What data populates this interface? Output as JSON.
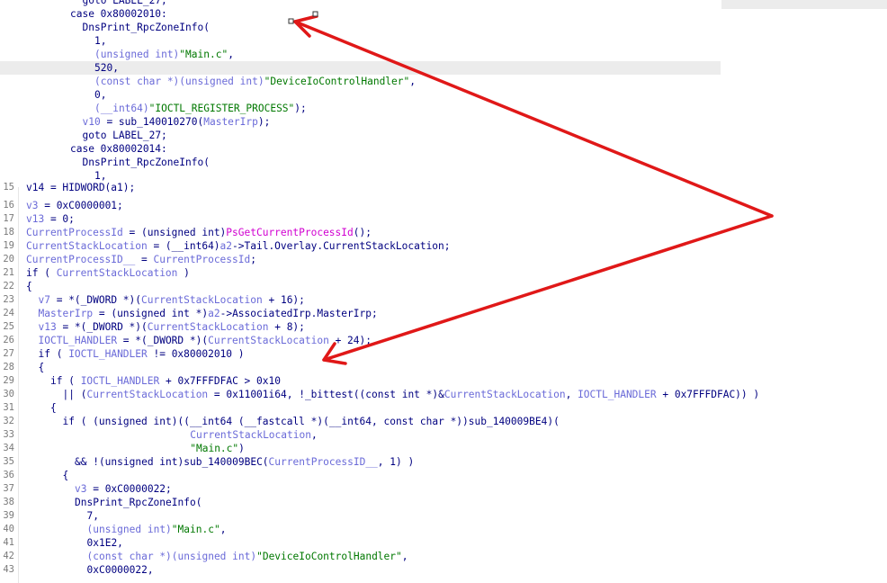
{
  "top_code": [
    {
      "indent": 10,
      "parts": [
        {
          "t": "goto LABEL_27;",
          "c": "kw"
        }
      ]
    },
    {
      "indent": 8,
      "parts": [
        {
          "t": "case 0x80002010:",
          "c": "kw"
        }
      ]
    },
    {
      "indent": 10,
      "parts": [
        {
          "t": "DnsPrint_RpcZoneInfo(",
          "c": "fn"
        }
      ]
    },
    {
      "indent": 12,
      "parts": [
        {
          "t": "1,",
          "c": "num"
        }
      ]
    },
    {
      "indent": 12,
      "parts": [
        {
          "t": "(unsigned int)",
          "c": "var"
        },
        {
          "t": "\"Main.c\"",
          "c": "str"
        },
        {
          "t": ",",
          "c": "kw"
        }
      ]
    },
    {
      "indent": 12,
      "parts": [
        {
          "t": "520,",
          "c": "num"
        }
      ],
      "highlight": true
    },
    {
      "indent": 12,
      "parts": [
        {
          "t": "(const char *)(unsigned int)",
          "c": "var"
        },
        {
          "t": "\"DeviceIoControlHandler\"",
          "c": "str"
        },
        {
          "t": ",",
          "c": "kw"
        }
      ]
    },
    {
      "indent": 12,
      "parts": [
        {
          "t": "0,",
          "c": "num"
        }
      ]
    },
    {
      "indent": 12,
      "parts": [
        {
          "t": "(__int64)",
          "c": "var"
        },
        {
          "t": "\"IOCTL_REGISTER_PROCESS\"",
          "c": "str"
        },
        {
          "t": ");",
          "c": "kw"
        }
      ]
    },
    {
      "indent": 10,
      "parts": [
        {
          "t": "v10",
          "c": "var"
        },
        {
          "t": " = sub_140010270(",
          "c": "kw"
        },
        {
          "t": "MasterIrp",
          "c": "var"
        },
        {
          "t": ");",
          "c": "kw"
        }
      ]
    },
    {
      "indent": 10,
      "parts": [
        {
          "t": "goto LABEL_27;",
          "c": "kw"
        }
      ]
    },
    {
      "indent": 8,
      "parts": [
        {
          "t": "case 0x80002014:",
          "c": "kw"
        }
      ]
    },
    {
      "indent": 10,
      "parts": [
        {
          "t": "DnsPrint_RpcZoneInfo(",
          "c": "fn"
        }
      ]
    },
    {
      "indent": 12,
      "parts": [
        {
          "t": "1,",
          "c": "num"
        }
      ]
    }
  ],
  "bottom_code": [
    {
      "n": "16",
      "indent": 0,
      "parts": [
        {
          "t": "v3",
          "c": "var"
        },
        {
          "t": " = 0xC0000001;",
          "c": "kw"
        }
      ]
    },
    {
      "n": "17",
      "indent": 0,
      "parts": [
        {
          "t": "v13",
          "c": "var"
        },
        {
          "t": " = 0;",
          "c": "kw"
        }
      ]
    },
    {
      "n": "18",
      "indent": 0,
      "parts": [
        {
          "t": "CurrentProcessId",
          "c": "var"
        },
        {
          "t": " = (unsigned int)",
          "c": "kw"
        },
        {
          "t": "PsGetCurrentProcessId",
          "c": "pink"
        },
        {
          "t": "();",
          "c": "kw"
        }
      ]
    },
    {
      "n": "19",
      "indent": 0,
      "parts": [
        {
          "t": "CurrentStackLocation",
          "c": "var"
        },
        {
          "t": " = (__int64)",
          "c": "kw"
        },
        {
          "t": "a2",
          "c": "var"
        },
        {
          "t": "->Tail.Overlay.CurrentStackLocation;",
          "c": "kw"
        }
      ]
    },
    {
      "n": "20",
      "indent": 0,
      "parts": [
        {
          "t": "CurrentProcessID__",
          "c": "var"
        },
        {
          "t": " = ",
          "c": "kw"
        },
        {
          "t": "CurrentProcessId",
          "c": "var"
        },
        {
          "t": ";",
          "c": "kw"
        }
      ]
    },
    {
      "n": "21",
      "indent": 0,
      "parts": [
        {
          "t": "if ( ",
          "c": "kw"
        },
        {
          "t": "CurrentStackLocation",
          "c": "var"
        },
        {
          "t": " )",
          "c": "kw"
        }
      ]
    },
    {
      "n": "22",
      "indent": 0,
      "parts": [
        {
          "t": "{",
          "c": "kw"
        }
      ]
    },
    {
      "n": "23",
      "indent": 2,
      "parts": [
        {
          "t": "v7",
          "c": "var"
        },
        {
          "t": " = *(_DWORD *)(",
          "c": "kw"
        },
        {
          "t": "CurrentStackLocation",
          "c": "var"
        },
        {
          "t": " + 16);",
          "c": "kw"
        }
      ]
    },
    {
      "n": "24",
      "indent": 2,
      "parts": [
        {
          "t": "MasterIrp",
          "c": "var"
        },
        {
          "t": " = (unsigned int *)",
          "c": "kw"
        },
        {
          "t": "a2",
          "c": "var"
        },
        {
          "t": "->AssociatedIrp.MasterIrp;",
          "c": "kw"
        }
      ]
    },
    {
      "n": "25",
      "indent": 2,
      "parts": [
        {
          "t": "v13",
          "c": "var"
        },
        {
          "t": " = *(_DWORD *)(",
          "c": "kw"
        },
        {
          "t": "CurrentStackLocation",
          "c": "var"
        },
        {
          "t": " + 8);",
          "c": "kw"
        }
      ]
    },
    {
      "n": "26",
      "indent": 2,
      "parts": [
        {
          "t": "IOCTL_HANDLER",
          "c": "var"
        },
        {
          "t": " = *(_DWORD *)(",
          "c": "kw"
        },
        {
          "t": "CurrentStackLocation",
          "c": "var"
        },
        {
          "t": " + 24);",
          "c": "kw"
        }
      ]
    },
    {
      "n": "27",
      "indent": 2,
      "parts": [
        {
          "t": "if ( ",
          "c": "kw"
        },
        {
          "t": "IOCTL_HANDLER",
          "c": "var"
        },
        {
          "t": " != 0x80002010 )",
          "c": "kw"
        }
      ]
    },
    {
      "n": "28",
      "indent": 2,
      "parts": [
        {
          "t": "{",
          "c": "kw"
        }
      ]
    },
    {
      "n": "29",
      "indent": 4,
      "parts": [
        {
          "t": "if ( ",
          "c": "kw"
        },
        {
          "t": "IOCTL_HANDLER",
          "c": "var"
        },
        {
          "t": " + 0x7FFFDFAC > 0x10",
          "c": "kw"
        }
      ]
    },
    {
      "n": "30",
      "indent": 6,
      "parts": [
        {
          "t": "|| (",
          "c": "kw"
        },
        {
          "t": "CurrentStackLocation",
          "c": "var"
        },
        {
          "t": " = 0x11001i64, !_bittest((const int *)&",
          "c": "kw"
        },
        {
          "t": "CurrentStackLocation",
          "c": "var"
        },
        {
          "t": ", ",
          "c": "kw"
        },
        {
          "t": "IOCTL_HANDLER",
          "c": "var"
        },
        {
          "t": " + 0x7FFFDFAC)) )",
          "c": "kw"
        }
      ]
    },
    {
      "n": "31",
      "indent": 4,
      "parts": [
        {
          "t": "{",
          "c": "kw"
        }
      ]
    },
    {
      "n": "32",
      "indent": 6,
      "parts": [
        {
          "t": "if ( (unsigned int)((__int64 (__fastcall *)(__int64, const char *))sub_140009BE4)(",
          "c": "kw"
        }
      ]
    },
    {
      "n": "33",
      "indent": 27,
      "parts": [
        {
          "t": "CurrentStackLocation",
          "c": "var"
        },
        {
          "t": ",",
          "c": "kw"
        }
      ]
    },
    {
      "n": "34",
      "indent": 27,
      "parts": [
        {
          "t": "\"Main.c\"",
          "c": "str"
        },
        {
          "t": ")",
          "c": "kw"
        }
      ]
    },
    {
      "n": "35",
      "indent": 8,
      "parts": [
        {
          "t": "&& !(unsigned int)sub_140009BEC(",
          "c": "kw"
        },
        {
          "t": "CurrentProcessID__",
          "c": "var"
        },
        {
          "t": ", 1) )",
          "c": "kw"
        }
      ]
    },
    {
      "n": "36",
      "indent": 6,
      "parts": [
        {
          "t": "{",
          "c": "kw"
        }
      ]
    },
    {
      "n": "37",
      "indent": 8,
      "parts": [
        {
          "t": "v3",
          "c": "var"
        },
        {
          "t": " = 0xC0000022;",
          "c": "kw"
        }
      ]
    },
    {
      "n": "38",
      "indent": 8,
      "parts": [
        {
          "t": "DnsPrint_RpcZoneInfo(",
          "c": "fn"
        }
      ]
    },
    {
      "n": "39",
      "indent": 10,
      "parts": [
        {
          "t": "7,",
          "c": "num"
        }
      ]
    },
    {
      "n": "40",
      "indent": 10,
      "parts": [
        {
          "t": "(unsigned int)",
          "c": "var"
        },
        {
          "t": "\"Main.c\"",
          "c": "str"
        },
        {
          "t": ",",
          "c": "kw"
        }
      ]
    },
    {
      "n": "41",
      "indent": 10,
      "parts": [
        {
          "t": "0x1E2,",
          "c": "num"
        }
      ]
    },
    {
      "n": "42",
      "indent": 10,
      "parts": [
        {
          "t": "(const char *)(unsigned int)",
          "c": "var"
        },
        {
          "t": "\"DeviceIoControlHandler\"",
          "c": "str"
        },
        {
          "t": ",",
          "c": "kw"
        }
      ]
    },
    {
      "n": "43",
      "indent": 10,
      "parts": [
        {
          "t": "0xC0000022,",
          "c": "num"
        }
      ]
    }
  ],
  "partial_line": {
    "n": "15",
    "text": "v14 = HIDWORD(a1);"
  },
  "colors": {
    "annotation_arrow": "#e01818",
    "highlight": "#ececec"
  }
}
